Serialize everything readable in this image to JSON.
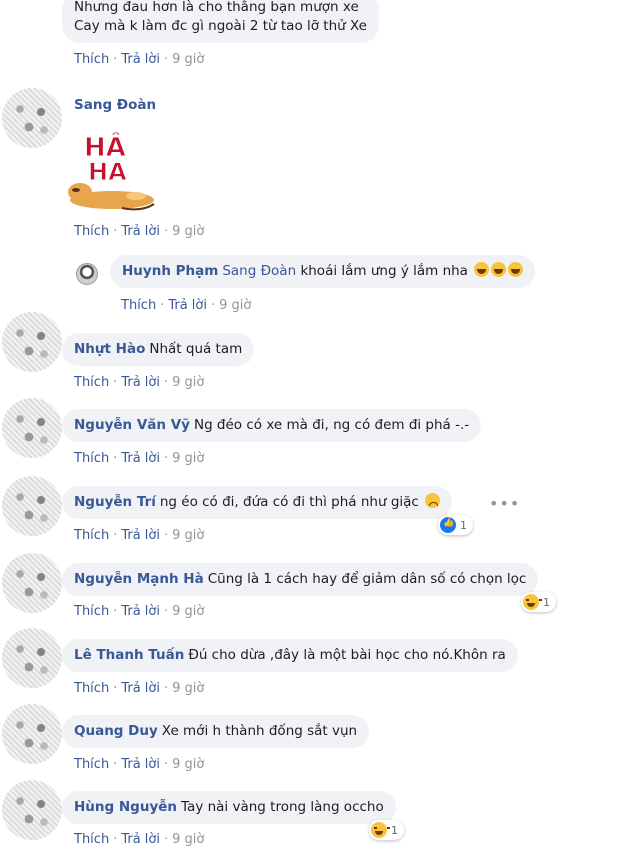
{
  "labels": {
    "like": "Thích",
    "reply": "Trả lời",
    "separator": "·"
  },
  "comments": [
    {
      "name": "",
      "text_line1": "Nhưng đau hơn là cho thằng bạn mượn xe",
      "text_line2": "Cay mà k làm đc gì ngoài 2 từ tao lỡ thử Xe",
      "time": "9 giờ"
    },
    {
      "name": "Sang Đoàn",
      "sticker_text": "HÂ HA",
      "time": "9 giờ"
    },
    {
      "name": "Huynh Phạm",
      "mention": "Sang Đoàn",
      "text": "khoái lắm ưng ý lắm nha",
      "time": "9 giờ"
    },
    {
      "name": "Nhựt Hào",
      "text": "Nhất quá tam",
      "time": "9 giờ"
    },
    {
      "name": "Nguyễn Văn Vỹ",
      "text": "Ng đéo có xe mà đi, ng có đem đi phá -.-",
      "time": "9 giờ"
    },
    {
      "name": "Nguyễn Trí",
      "text": "ng éo có đi, đứa có đi thì phá như giặc",
      "time": "9 giờ",
      "reaction_count": "1",
      "more_icon": "ellipsis-icon"
    },
    {
      "name": "Nguyễn Mạnh Hà",
      "text": "Cũng là 1 cách hay để giảm dân số có chọn lọc",
      "time": "9 giờ",
      "reaction_count": "1"
    },
    {
      "name": "Lê Thanh Tuấn",
      "text": "Đú cho dừa ,đây là một bài học cho nó.Khôn ra",
      "time": "9 giờ"
    },
    {
      "name": "Quang Duy",
      "text": "Xe mới h thành đống sắt vụn",
      "time": "9 giờ"
    },
    {
      "name": "Hùng Nguyễn",
      "text": "Tay nài vàng trong làng occho",
      "time": "9 giờ",
      "reaction_count": "1"
    }
  ],
  "colors": {
    "link": "#385898",
    "bubble": "#f0f2f5",
    "meta": "#90949c",
    "like_blue": "#1877f2"
  }
}
